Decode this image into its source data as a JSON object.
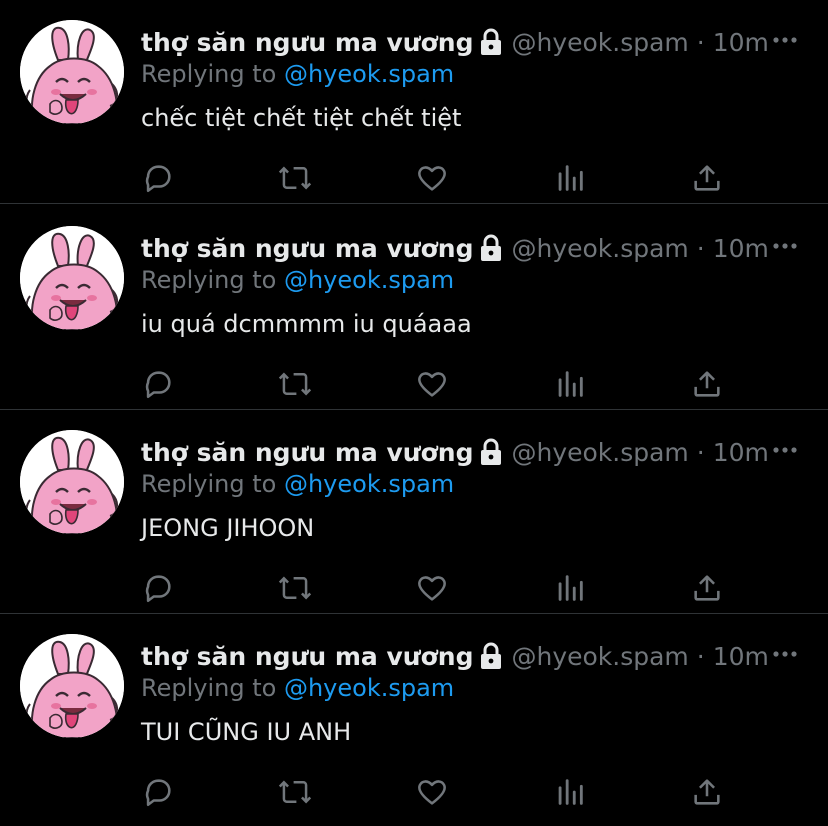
{
  "colors": {
    "background": "#000000",
    "text_primary": "#e7e9ea",
    "text_secondary": "#71767b",
    "accent": "#1d9bf0",
    "divider": "#2f3336",
    "avatar_skin": "#f2a3c7"
  },
  "icons": {
    "lock": "lock-icon",
    "more": "more-horizontal-icon",
    "reply": "reply-bubble-icon",
    "retweet": "retweet-icon",
    "like": "heart-icon",
    "views": "bar-chart-icon",
    "share": "share-upload-icon"
  },
  "tweets": [
    {
      "display_name": "thợ săn ngưu ma vương",
      "handle": "@hyeok.spam",
      "separator": "·",
      "time": "10m",
      "replying_prefix": "Replying to",
      "replying_to": "@hyeok.spam",
      "text": "chếc tiệt chết tiệt chết tiệt"
    },
    {
      "display_name": "thợ săn ngưu ma vương",
      "handle": "@hyeok.spam",
      "separator": "·",
      "time": "10m",
      "replying_prefix": "Replying to",
      "replying_to": "@hyeok.spam",
      "text": "iu quá dcmmmm iu quáaaa"
    },
    {
      "display_name": "thợ săn ngưu ma vương",
      "handle": "@hyeok.spam",
      "separator": "·",
      "time": "10m",
      "replying_prefix": "Replying to",
      "replying_to": "@hyeok.spam",
      "text": "JEONG JIHOON"
    },
    {
      "display_name": "thợ săn ngưu ma vương",
      "handle": "@hyeok.spam",
      "separator": "·",
      "time": "10m",
      "replying_prefix": "Replying to",
      "replying_to": "@hyeok.spam",
      "text": "TUI CŨNG IU ANH"
    }
  ]
}
